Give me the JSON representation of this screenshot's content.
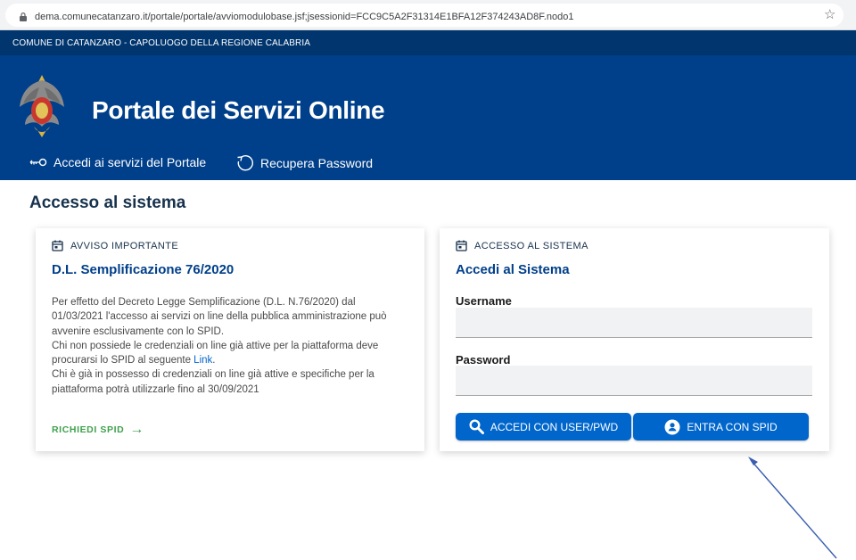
{
  "browser": {
    "url": "dema.comunecatanzaro.it/portale/portale/avviomodulobase.jsf;jsessionid=FCC9C5A2F31314E1BFA12F374243AD8F.nodo1"
  },
  "topbar": {
    "text": "COMUNE DI CATANZARO - CAPOLUOGO DELLA REGIONE CALABRIA"
  },
  "header": {
    "title": "Portale dei Servizi Online",
    "nav": [
      {
        "label": "Accedi ai servizi del Portale",
        "icon": "key-icon"
      },
      {
        "label": "Recupera Password",
        "icon": "refresh-icon"
      }
    ]
  },
  "page": {
    "title": "Accesso al sistema"
  },
  "notice": {
    "kicker": "AVVISO IMPORTANTE",
    "heading": "D.L. Semplificazione 76/2020",
    "line1": "Per effetto del Decreto Legge Semplificazione (D.L. N.76/2020) dal",
    "line2": "01/03/2021 l'accesso ai servizi on line della pubblica amministrazione può",
    "line3": "avvenire esclusivamente con lo SPID.",
    "line4": "Chi non possiede le credenziali on line già attive per la piattaforma deve",
    "line5_pre": "procurarsi lo SPID al seguente",
    "link": "Link",
    "line5_post": ".",
    "line6": "Chi è già in possesso di credenziali on line già attive e specifiche per la",
    "line7": "piattaforma potrà utilizzarle fino al 30/09/2021",
    "cta": "RICHIEDI SPID",
    "cta_arrow": "→"
  },
  "login": {
    "kicker": "ACCESSO AL SISTEMA",
    "heading": "Accedi al Sistema",
    "username_label": "Username",
    "username_value": "",
    "password_label": "Password",
    "password_value": "",
    "btn_user": "ACCEDI CON USER/PWD",
    "btn_spid": "ENTRA CON SPID"
  },
  "colors": {
    "header_bg": "#003f8a",
    "topbar_bg": "#00356e",
    "primary_button": "#0066cc",
    "cta_green": "#3fa04d",
    "annotation_arrow": "#3a5fb0"
  }
}
